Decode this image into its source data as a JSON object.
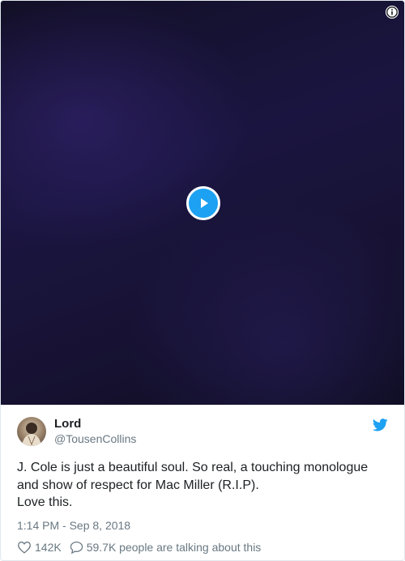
{
  "tweet": {
    "author_name": "Lord",
    "author_handle": "@TousenCollins",
    "text_lines": [
      "J. Cole is just a beautiful soul. So real, a touching monologue",
      "and show of respect for Mac Miller (R.I.P).",
      "Love this."
    ],
    "timestamp": "1:14 PM - Sep 8, 2018",
    "likes": "142K",
    "conversation": "59.7K people are talking about this"
  },
  "icons": {
    "info": "info-icon",
    "play": "play-icon",
    "brand": "twitter-bird-icon",
    "like": "heart-icon",
    "reply": "speech-bubble-icon"
  },
  "colors": {
    "brand_blue": "#1da1f2",
    "media_background": "#161232",
    "secondary_text": "#697882"
  }
}
